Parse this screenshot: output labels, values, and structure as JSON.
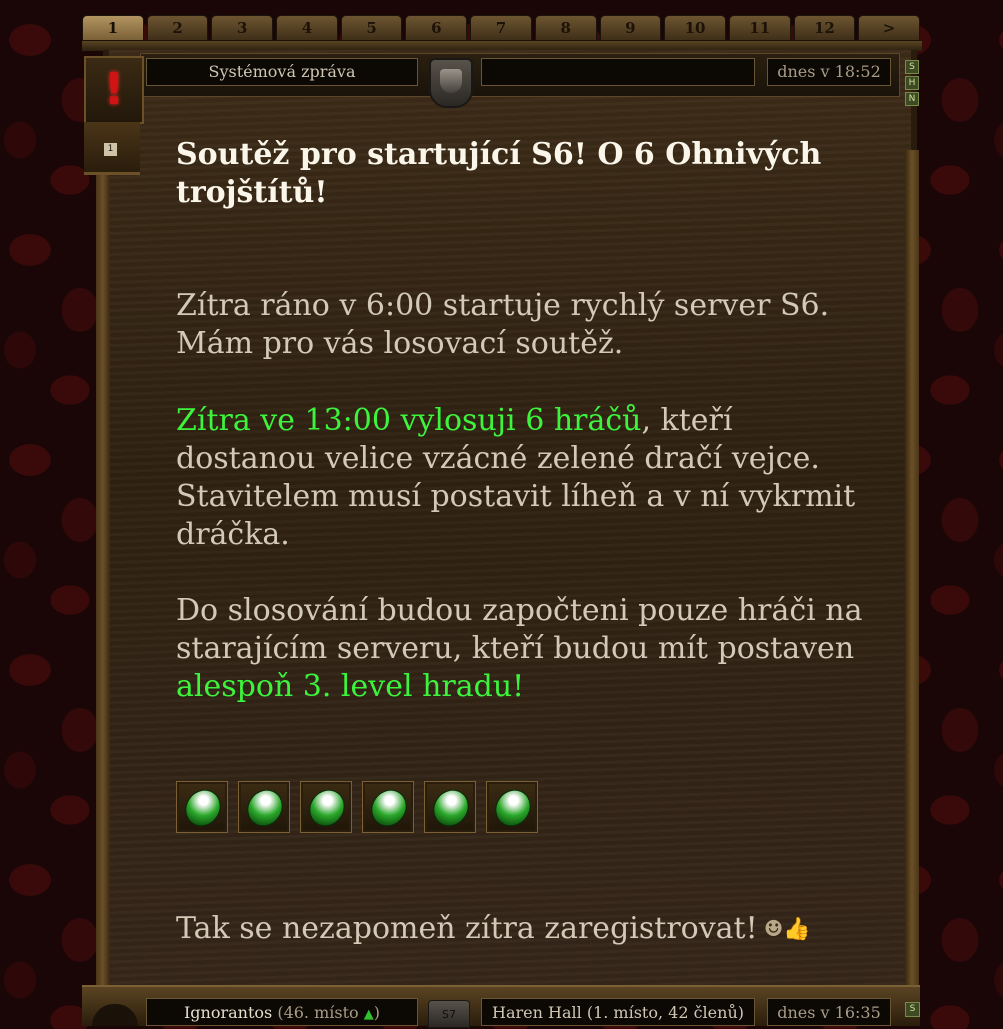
{
  "tabs": [
    "1",
    "2",
    "3",
    "4",
    "5",
    "6",
    "7",
    "8",
    "9",
    "10",
    "11",
    "12",
    ">"
  ],
  "active_tab": "1",
  "message": {
    "type_label": "Systémová zpráva",
    "sender": "",
    "date": "dnes v 18:52",
    "alert_icon": "!",
    "count_badge": "1",
    "flags": [
      "S",
      "H",
      "N"
    ],
    "title": "Soutěž pro startující S6! O 6 Ohnivých trojštítů!",
    "para1": "Zítra ráno v 6:00 startuje rychlý server S6. Mám pro vás losovací soutěž.",
    "para2_highlight": "Zítra ve 13:00 vylosuji 6 hráčů",
    "para2_rest": ", kteří dostanou velice vzácné zelené dračí vejce. Stavitelem musí postavit líheň a v ní vykrmit dráčka.",
    "para3_start": "Do slosování budou započteni pouze hráči na starajícím serveru, kteří budou mít postaven ",
    "para3_highlight": "alespoň 3. level hradu!",
    "reward_items": [
      "green-dragon-egg",
      "green-dragon-egg",
      "green-dragon-egg",
      "green-dragon-egg",
      "green-dragon-egg",
      "green-dragon-egg"
    ],
    "closing": "Tak se nezapomeň zítra zaregistrovat!",
    "closing_emotes": "☻👍"
  },
  "next_message": {
    "player": "Ignorantos",
    "rank": "(46. místo",
    "rank_arrow": "▲",
    "rank_close": ")",
    "server": "S7",
    "clan": "Haren Hall (1. místo, 42 členů)",
    "date": "dnes v 16:35",
    "flag": "S"
  },
  "colors": {
    "highlight_green": "#3df43d",
    "title_white": "#fbf6ea",
    "body_text": "#d3c9b8",
    "alert_red": "#d01414"
  }
}
